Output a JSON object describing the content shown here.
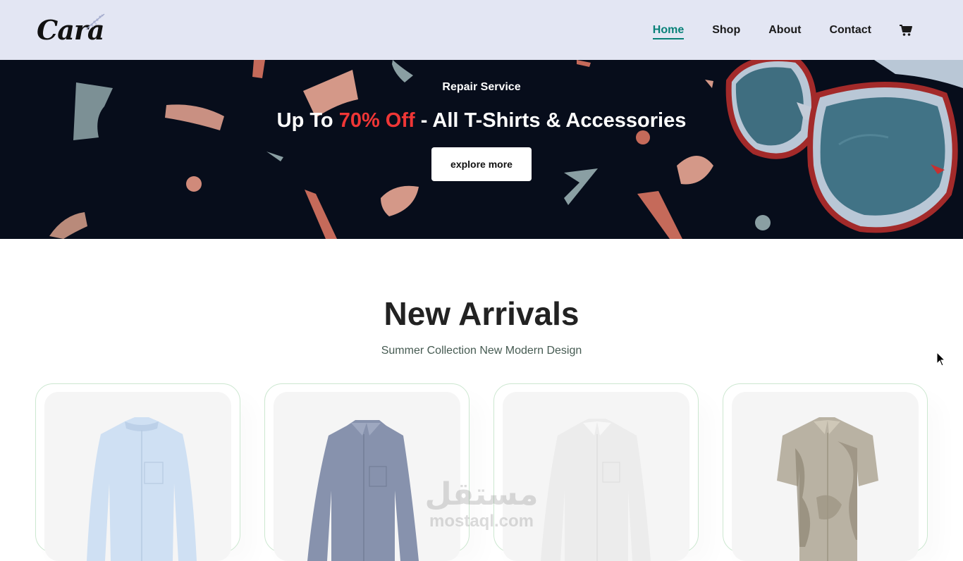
{
  "brand": {
    "logo_text": "Cara"
  },
  "nav": {
    "items": [
      {
        "label": "Home",
        "active": true
      },
      {
        "label": "Shop",
        "active": false
      },
      {
        "label": "About",
        "active": false
      },
      {
        "label": "Contact",
        "active": false
      }
    ],
    "cart_icon": "shopping-cart-icon"
  },
  "hero": {
    "subtitle": "Repair Service",
    "title_prefix": "Up To ",
    "title_highlight": "70% Off",
    "title_suffix": " - All T-Shirts & Accessories",
    "button_label": "explore more",
    "background_color": "#070d1b",
    "highlight_color": "#ef3636"
  },
  "section": {
    "title": "New Arrivals",
    "subtitle": "Summer Collection New Modern Design"
  },
  "products": [
    {
      "image": "light-blue-shirt",
      "color": "#cfe0f3"
    },
    {
      "image": "gray-blue-shirt",
      "color": "#8792ad"
    },
    {
      "image": "white-shirt",
      "color": "#ececec"
    },
    {
      "image": "printed-short-sleeve-shirt",
      "color": "#b9b2a3"
    }
  ],
  "watermark": {
    "arabic": "مستقل",
    "latin": "mostaql.com"
  },
  "colors": {
    "accent": "#088178",
    "header_bg": "#e3e6f3"
  }
}
